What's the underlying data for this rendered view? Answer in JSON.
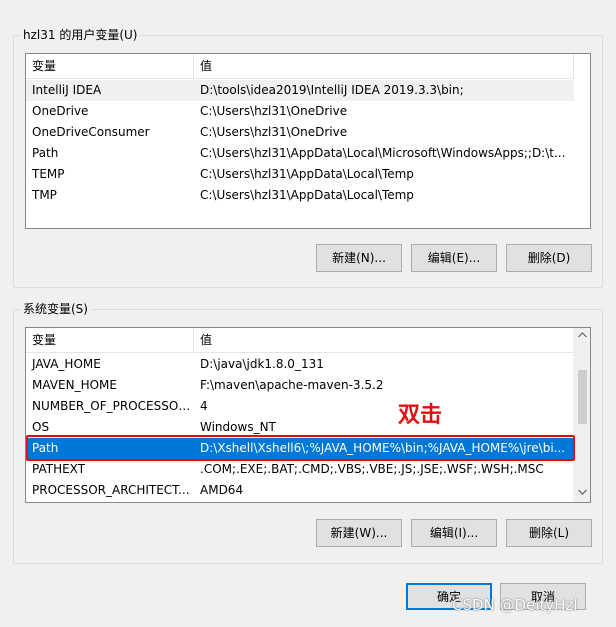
{
  "user_vars": {
    "title": "hzl31 的用户变量(U)",
    "columns": [
      "变量",
      "值"
    ],
    "rows": [
      {
        "name": "IntelliJ IDEA",
        "value": "D:\\tools\\idea2019\\IntelliJ IDEA 2019.3.3\\bin;"
      },
      {
        "name": "OneDrive",
        "value": "C:\\Users\\hzl31\\OneDrive"
      },
      {
        "name": "OneDriveConsumer",
        "value": "C:\\Users\\hzl31\\OneDrive"
      },
      {
        "name": "Path",
        "value": "C:\\Users\\hzl31\\AppData\\Local\\Microsoft\\WindowsApps;;D:\\t..."
      },
      {
        "name": "TEMP",
        "value": "C:\\Users\\hzl31\\AppData\\Local\\Temp"
      },
      {
        "name": "TMP",
        "value": "C:\\Users\\hzl31\\AppData\\Local\\Temp"
      }
    ],
    "buttons": {
      "new": "新建(N)...",
      "edit": "编辑(E)...",
      "delete": "删除(D)"
    }
  },
  "system_vars": {
    "title": "系统变量(S)",
    "columns": [
      "变量",
      "值"
    ],
    "rows": [
      {
        "name": "JAVA_HOME",
        "value": "D:\\java\\jdk1.8.0_131"
      },
      {
        "name": "MAVEN_HOME",
        "value": "F:\\maven\\apache-maven-3.5.2"
      },
      {
        "name": "NUMBER_OF_PROCESSORS",
        "value": "4"
      },
      {
        "name": "OS",
        "value": "Windows_NT"
      },
      {
        "name": "Path",
        "value": "D:\\Xshell\\Xshell6\\;%JAVA_HOME%\\bin;%JAVA_HOME%\\jre\\bi..."
      },
      {
        "name": "PATHEXT",
        "value": ".COM;.EXE;.BAT;.CMD;.VBS;.VBE;.JS;.JSE;.WSF;.WSH;.MSC"
      },
      {
        "name": "PROCESSOR_ARCHITECT...",
        "value": "AMD64"
      }
    ],
    "buttons": {
      "new": "新建(W)...",
      "edit": "编辑(I)...",
      "delete": "删除(L)"
    }
  },
  "annotation": "双击",
  "dialog_buttons": {
    "ok": "确定",
    "cancel": "取消"
  },
  "watermark": "CSDN @DeityHzl",
  "icons": {
    "scroll_up": "chevron-up-icon",
    "scroll_down": "chevron-down-icon"
  },
  "colors": {
    "selection": "#0078d7",
    "highlight_box": "#e01010",
    "default_button_border": "#0078d7"
  }
}
